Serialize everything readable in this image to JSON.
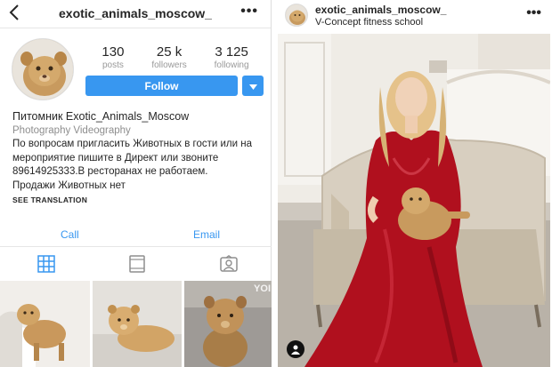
{
  "profile": {
    "username": "exotic_animals_moscow_",
    "stats": [
      {
        "num": "130",
        "label": "posts"
      },
      {
        "num": "25 k",
        "label": "followers"
      },
      {
        "num": "3 125",
        "label": "following"
      }
    ],
    "follow_label": "Follow",
    "bio": {
      "name": "Питомник Exotic_Animals_Moscow",
      "category": "Photography Videography",
      "line1": "По вопросам пригласить Животных в гости или на",
      "line2": "мероприятие пишите в Директ или звоните",
      "line3": "89614925333.В ресторанах не работаем.",
      "line4": "Продажи Животных нет"
    },
    "see_translation": "SEE TRANSLATION",
    "actions": {
      "call": "Call",
      "email": "Email"
    },
    "watermark": "YOI"
  },
  "post": {
    "username": "exotic_animals_moscow_",
    "location": "V-Concept fitness school"
  },
  "colors": {
    "accent": "#3897f0",
    "muted": "#8e8e8e",
    "dress": "#b0101e"
  },
  "icons": [
    "back-arrow-icon",
    "more-options-icon",
    "dropdown-chevron-icon",
    "grid-view-icon",
    "list-view-icon",
    "tagged-icon",
    "user-tag-icon"
  ]
}
